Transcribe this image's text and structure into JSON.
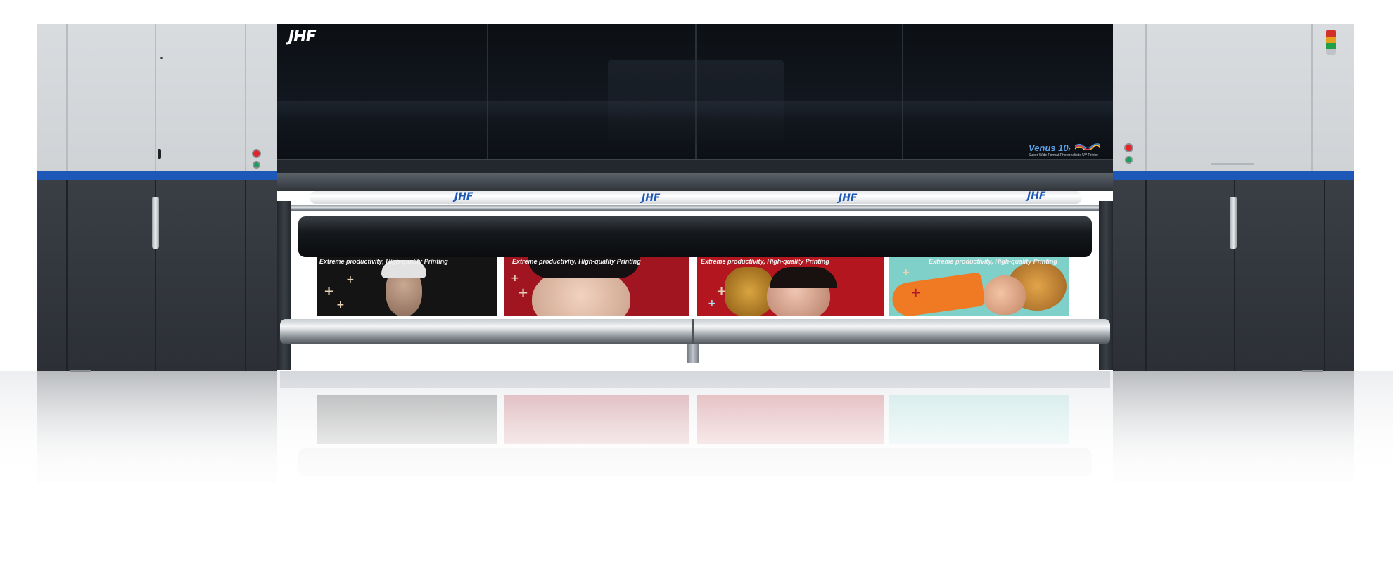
{
  "brand": {
    "logo": "JHF",
    "media_logos": [
      "JHF",
      "JHF",
      "JHF",
      "JHF"
    ]
  },
  "model": {
    "name": "Venus 10",
    "suffix": "r",
    "tagline": "Super Wide Format Photorealistic UV Printer"
  },
  "prints": {
    "captions": [
      "Extreme productivity, High-quality Printing",
      "Extreme productivity, High-quality Printing",
      "Extreme productivity, High-quality Printing",
      "Extreme productivity, High-quality Printing"
    ]
  },
  "colors": {
    "accent_stripe": "#1d57b8",
    "hood": "#0c0f13",
    "cabinet_light": "#d9dcdf",
    "cabinet_dark": "#2c3036",
    "estop_red": "#e0262a",
    "status_green": "#1aa058"
  },
  "icons": [
    "emergency-stop-button",
    "green-status-button",
    "signal-tower-icon",
    "wave-logo-icon"
  ]
}
